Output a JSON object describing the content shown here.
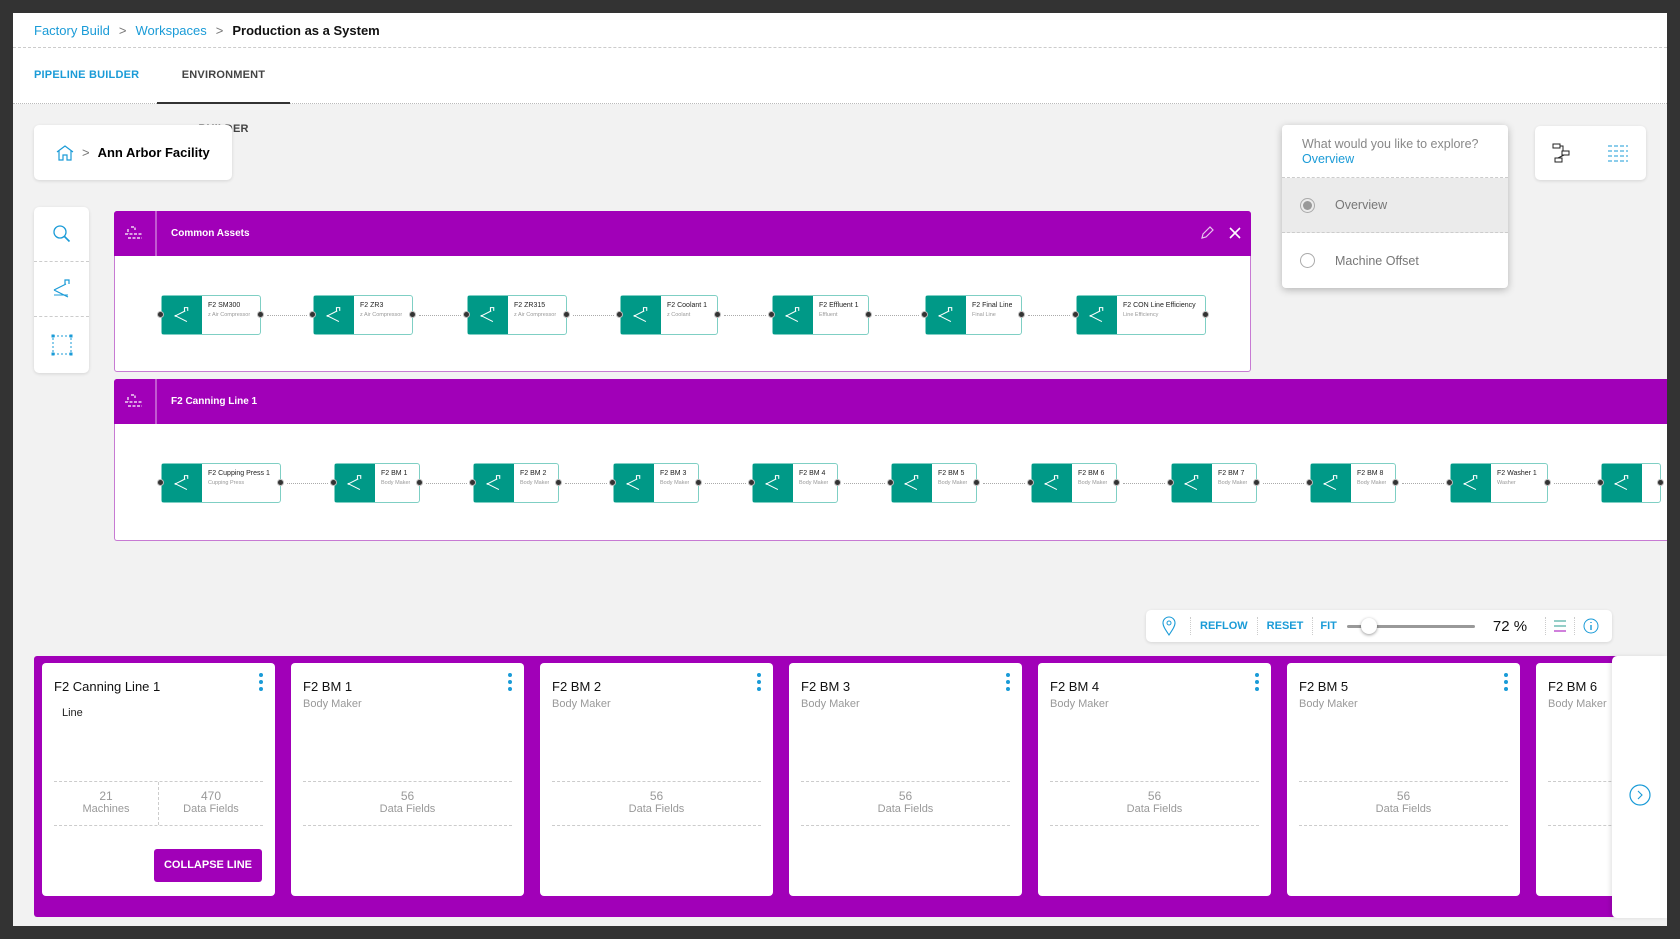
{
  "breadcrumb": [
    "Factory Build",
    "Workspaces",
    "Production as a System"
  ],
  "tabs": [
    "PIPELINE BUILDER",
    "ENVIRONMENT BUILDER"
  ],
  "facility": "Ann Arbor Facility",
  "explore": {
    "question": "What would you like to explore?",
    "value": "Overview",
    "options": [
      {
        "label": "Overview",
        "selected": true
      },
      {
        "label": "Machine Offset",
        "selected": false
      }
    ]
  },
  "panels": [
    {
      "title": "Common Assets",
      "nodes": [
        [
          "F2 SM300",
          "z Air Compressor"
        ],
        [
          "F2 ZR3",
          "z Air Compressor"
        ],
        [
          "F2 ZR315",
          "z Air Compressor"
        ],
        [
          "F2 Coolant 1",
          "z Coolant"
        ],
        [
          "F2 Effluent 1",
          "Effluent"
        ],
        [
          "F2 Final Line",
          "Final Line"
        ],
        [
          "F2 CON Line Efficiency",
          "Line Efficiency"
        ]
      ]
    },
    {
      "title": "F2 Canning Line 1",
      "nodes": [
        [
          "F2 Cupping Press 1",
          "Cupping Press"
        ],
        [
          "F2 BM 1",
          "Body Maker"
        ],
        [
          "F2 BM 2",
          "Body Maker"
        ],
        [
          "F2 BM 3",
          "Body Maker"
        ],
        [
          "F2 BM 4",
          "Body Maker"
        ],
        [
          "F2 BM 5",
          "Body Maker"
        ],
        [
          "F2 BM 6",
          "Body Maker"
        ],
        [
          "F2 BM 7",
          "Body Maker"
        ],
        [
          "F2 BM 8",
          "Body Maker"
        ],
        [
          "F2 Washer 1",
          "Washer"
        ],
        [
          "",
          ""
        ]
      ]
    }
  ],
  "zoombar": {
    "reflow": "REFLOW",
    "reset": "RESET",
    "fit": "FIT",
    "zoom_percent": 72,
    "zoom_label": "72 %"
  },
  "cards": [
    {
      "title": "F2 Canning Line 1",
      "subtitle": "Line",
      "stats": [
        [
          "21",
          "Machines"
        ],
        [
          "470",
          "Data Fields"
        ]
      ],
      "button": "COLLAPSE LINE"
    },
    {
      "title": "F2 BM 1",
      "subtitle": "Body Maker",
      "stats": [
        [
          "56",
          "Data Fields"
        ]
      ]
    },
    {
      "title": "F2 BM 2",
      "subtitle": "Body Maker",
      "stats": [
        [
          "56",
          "Data Fields"
        ]
      ]
    },
    {
      "title": "F2 BM 3",
      "subtitle": "Body Maker",
      "stats": [
        [
          "56",
          "Data Fields"
        ]
      ]
    },
    {
      "title": "F2 BM 4",
      "subtitle": "Body Maker",
      "stats": [
        [
          "56",
          "Data Fields"
        ]
      ]
    },
    {
      "title": "F2 BM 5",
      "subtitle": "Body Maker",
      "stats": [
        [
          "56",
          "Data Fields"
        ]
      ]
    },
    {
      "title": "F2 BM 6",
      "subtitle": "Body Maker",
      "stats": []
    }
  ],
  "colors": {
    "accent": "#1a9bd7",
    "purple": "#a100b8",
    "teal": "#009987"
  }
}
